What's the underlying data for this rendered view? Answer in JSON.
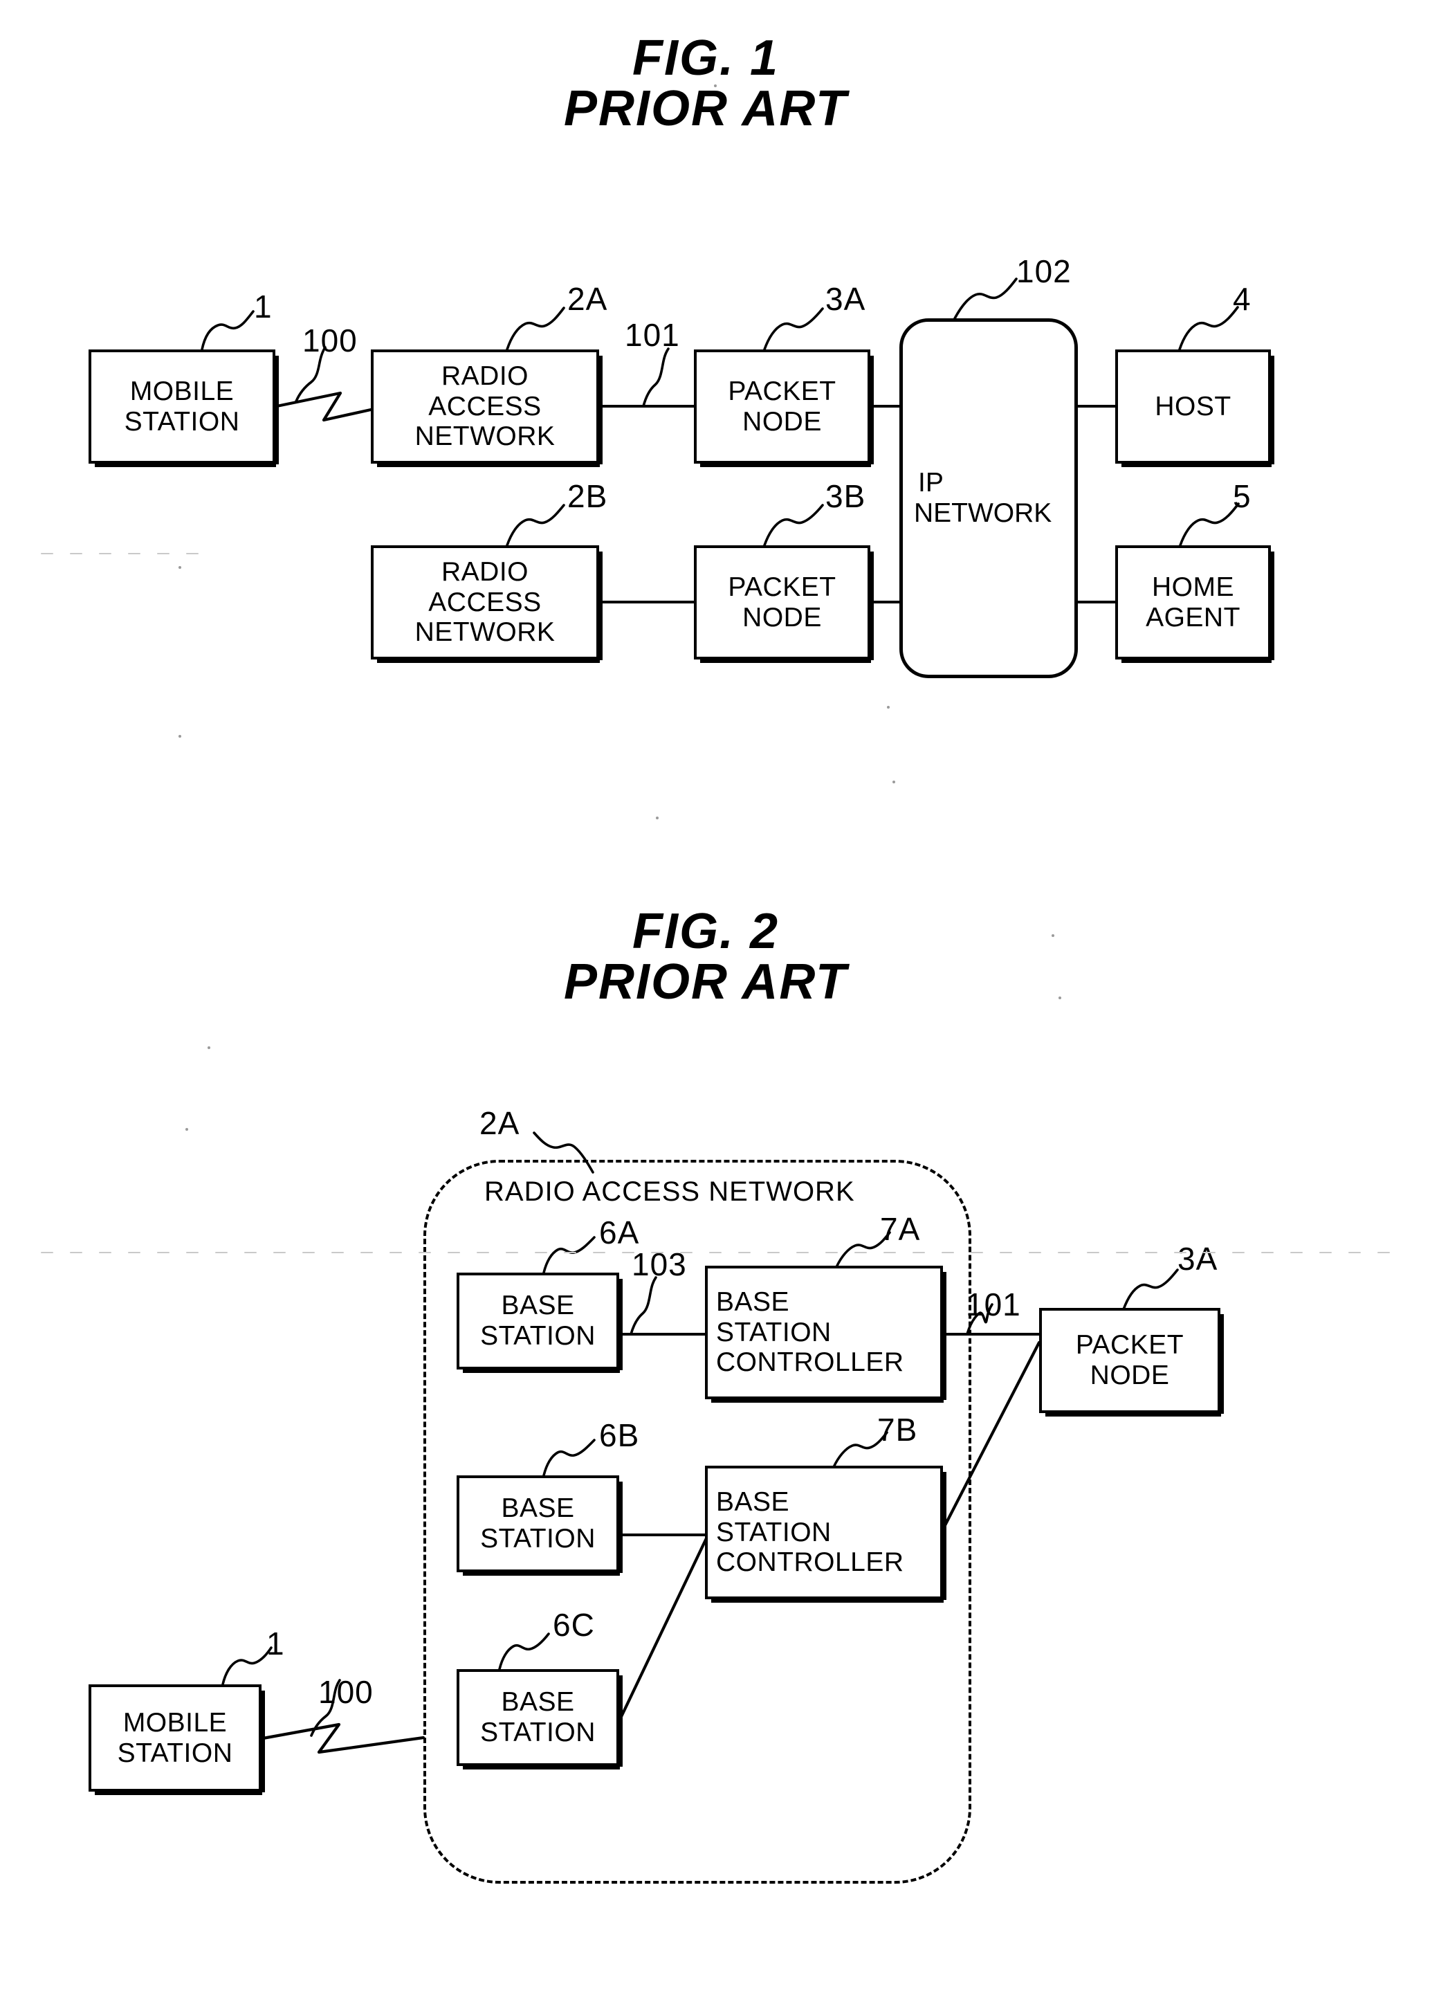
{
  "document": {
    "type": "patent-drawing-sheet",
    "background_color": "#ffffff",
    "line_color": "#000000"
  },
  "figures": [
    {
      "id": "fig1",
      "title_line1": "FIG. 1",
      "title_line2": "PRIOR ART",
      "boxes": [
        {
          "id": "f1-mobile-station",
          "label_lines": [
            "MOBILE",
            "STATION"
          ],
          "ref": "1"
        },
        {
          "id": "f1-ran-a",
          "label_lines": [
            "RADIO",
            "ACCESS",
            "NETWORK"
          ],
          "ref": "2A"
        },
        {
          "id": "f1-packet-node-a",
          "label_lines": [
            "PACKET",
            "NODE"
          ],
          "ref": "3A"
        },
        {
          "id": "f1-ip-network",
          "label_lines": [
            "IP",
            "NETWORK"
          ],
          "ref": "102"
        },
        {
          "id": "f1-host",
          "label_lines": [
            "HOST"
          ],
          "ref": "4"
        },
        {
          "id": "f1-ran-b",
          "label_lines": [
            "RADIO",
            "ACCESS",
            "NETWORK"
          ],
          "ref": "2B"
        },
        {
          "id": "f1-packet-node-b",
          "label_lines": [
            "PACKET",
            "NODE"
          ],
          "ref": "3B"
        },
        {
          "id": "f1-home-agent",
          "label_lines": [
            "HOME",
            "AGENT"
          ],
          "ref": "5"
        }
      ],
      "link_refs": [
        {
          "id": "f1-radio-link",
          "ref": "100",
          "kind": "wireless"
        },
        {
          "id": "f1-link-101",
          "ref": "101",
          "kind": "wired"
        }
      ]
    },
    {
      "id": "fig2",
      "title_line1": "FIG. 2",
      "title_line2": "PRIOR ART",
      "enclosure": {
        "id": "f2-ran-enclosure",
        "label": "RADIO ACCESS NETWORK",
        "ref": "2A"
      },
      "boxes": [
        {
          "id": "f2-base-station-a",
          "label_lines": [
            "BASE",
            "STATION"
          ],
          "ref": "6A"
        },
        {
          "id": "f2-bsc-a",
          "label_lines": [
            "BASE",
            "STATION",
            "CONTROLLER"
          ],
          "ref": "7A"
        },
        {
          "id": "f2-base-station-b",
          "label_lines": [
            "BASE",
            "STATION"
          ],
          "ref": "6B"
        },
        {
          "id": "f2-bsc-b",
          "label_lines": [
            "BASE",
            "STATION",
            "CONTROLLER"
          ],
          "ref": "7B"
        },
        {
          "id": "f2-base-station-c",
          "label_lines": [
            "BASE",
            "STATION"
          ],
          "ref": "6C"
        },
        {
          "id": "f2-packet-node-a",
          "label_lines": [
            "PACKET",
            "NODE"
          ],
          "ref": "3A"
        },
        {
          "id": "f2-mobile-station",
          "label_lines": [
            "MOBILE",
            "STATION"
          ],
          "ref": "1"
        }
      ],
      "link_refs": [
        {
          "id": "f2-radio-link",
          "ref": "100",
          "kind": "wireless"
        },
        {
          "id": "f2-link-103",
          "ref": "103",
          "kind": "wired"
        },
        {
          "id": "f2-link-101",
          "ref": "101",
          "kind": "wired"
        }
      ]
    }
  ]
}
